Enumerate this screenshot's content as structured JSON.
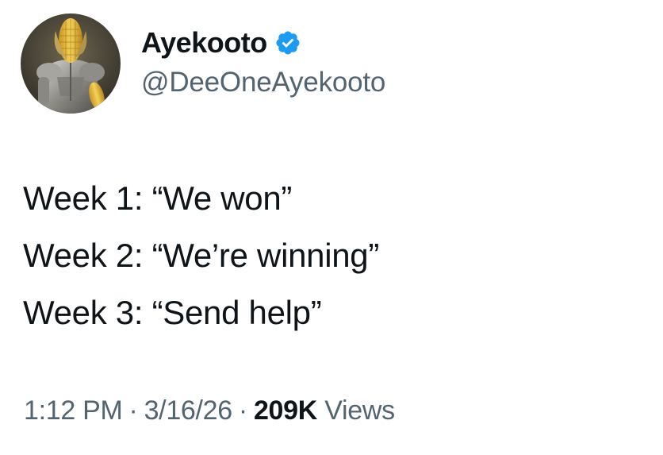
{
  "author": {
    "display_name": "Ayekooto",
    "handle": "@DeeOneAyekooto",
    "verified": true,
    "verified_color": "#1d9bf0",
    "avatar_icon": "corn-knight-avatar"
  },
  "tweet": {
    "lines": [
      "Week 1: “We won”",
      "Week 2: “We’re winning”",
      "Week 3: “Send help”"
    ]
  },
  "meta": {
    "time": "1:12 PM",
    "separator": "·",
    "date": "3/16/26",
    "views_count": "209K",
    "views_label": "Views"
  }
}
